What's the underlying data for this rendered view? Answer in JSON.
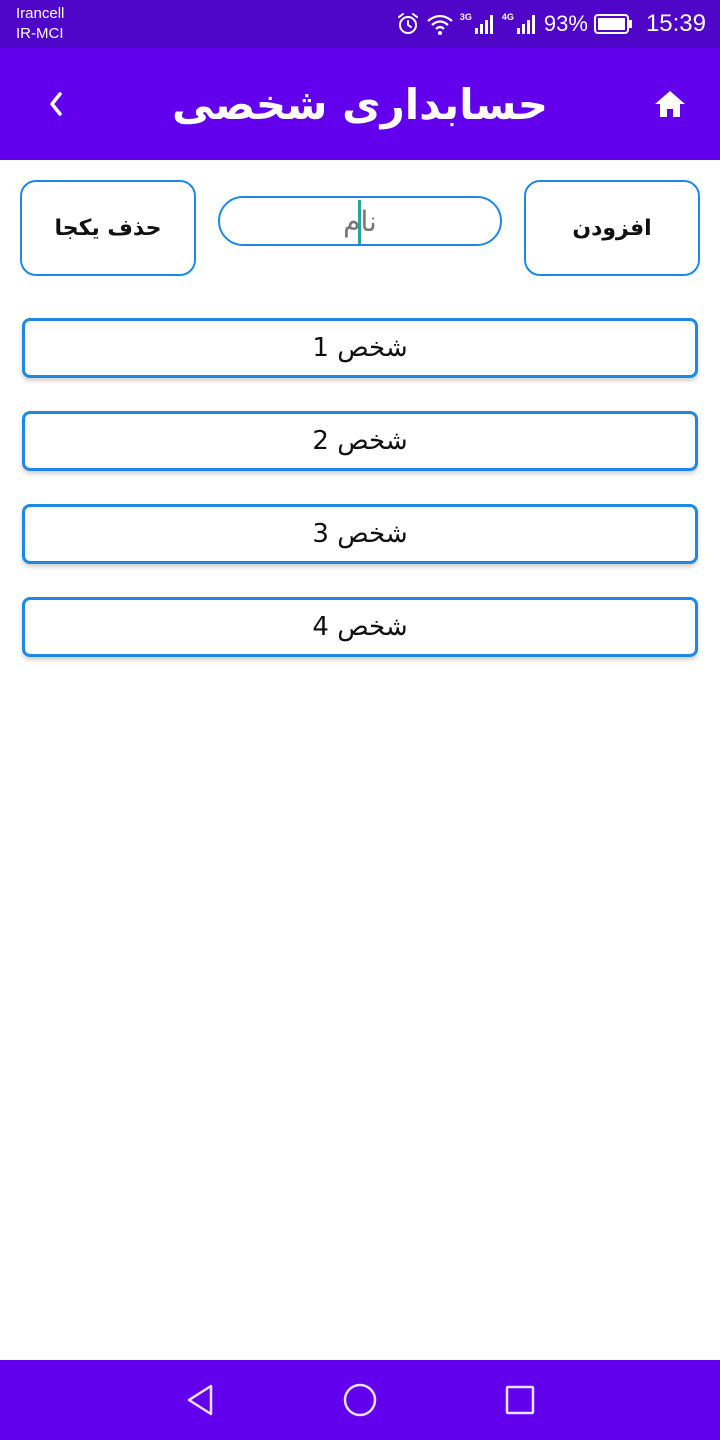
{
  "status_bar": {
    "carrier_1": "Irancell",
    "carrier_2": "IR-MCI",
    "network_1": "3G",
    "network_2": "4G",
    "battery": "93%",
    "time": "15:39",
    "icons": [
      "alarm-icon",
      "wifi-icon",
      "signal-icon",
      "signal-icon",
      "battery-icon"
    ]
  },
  "app_bar": {
    "title": "حسابداری شخصی",
    "back_icon": "chevron-left-icon",
    "home_icon": "home-icon"
  },
  "controls": {
    "delete_all_label": "حذف یکجا",
    "add_label": "افزودن",
    "name_placeholder": "نام",
    "name_value": ""
  },
  "persons": [
    {
      "label": "شخص 1"
    },
    {
      "label": "شخص 2"
    },
    {
      "label": "شخص 3"
    },
    {
      "label": "شخص 4"
    }
  ],
  "nav_bar": {
    "icons": [
      "back-triangle-icon",
      "home-circle-icon",
      "recents-square-icon"
    ]
  },
  "colors": {
    "status_bar": "#4f06c9",
    "app_bar": "#6200ee",
    "accent_border": "#1e88e5",
    "caret": "#26a69a"
  }
}
